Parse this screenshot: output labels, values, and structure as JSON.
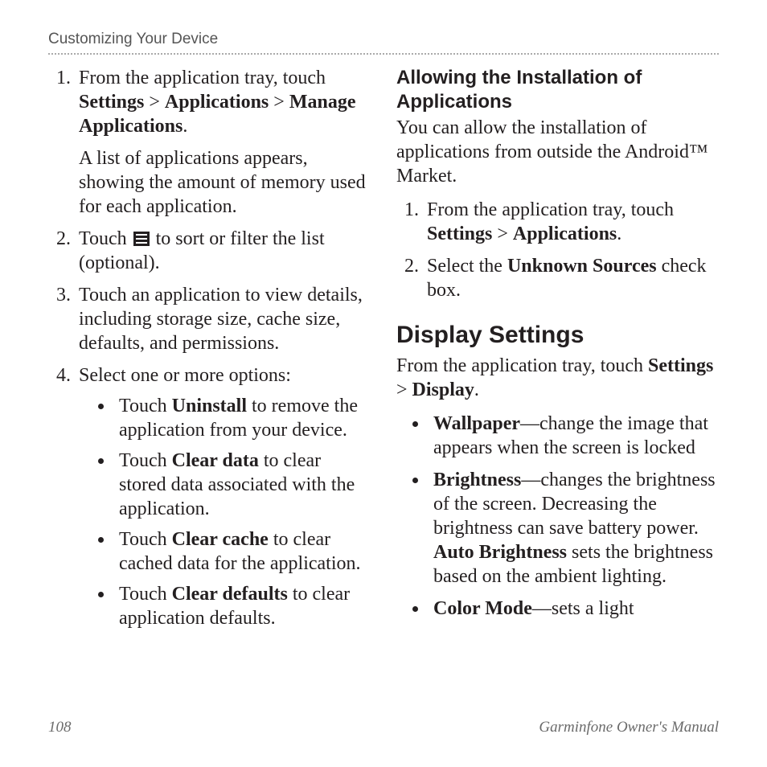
{
  "runningHead": "Customizing Your Device",
  "left": {
    "step1": {
      "prefix": "From the application tray, touch ",
      "b1": "Settings",
      "sep1": " > ",
      "b2": "Applications",
      "sep2": " > ",
      "b3": "Manage Applications",
      "suffix": ".",
      "follow": "A list of applications appears, showing the amount of memory used for each application."
    },
    "step2": {
      "prefix": "Touch ",
      "suffix": " to sort or filter the list (optional)."
    },
    "step3": "Touch an application to view details, including storage size, cache size, defaults, and permissions.",
    "step4": {
      "lead": "Select one or more options:",
      "opt1": {
        "p": "Touch ",
        "b": "Uninstall",
        "s": " to remove the application from your device."
      },
      "opt2": {
        "p": "Touch ",
        "b": "Clear data",
        "s": " to clear stored data associated with the application."
      },
      "opt3": {
        "p": "Touch ",
        "b": "Clear cache",
        "s": " to clear cached data for the application."
      },
      "opt4": {
        "p": "Touch ",
        "b": "Clear defaults",
        "s": " to clear application defaults."
      }
    }
  },
  "right": {
    "secTitle": "Allowing the Installation of Applications",
    "secIntro": "You can allow the installation of applications from outside the Android™ Market.",
    "step1": {
      "prefix": "From the application tray, touch ",
      "b1": "Settings",
      "sep1": " > ",
      "b2": "Applications",
      "suffix": "."
    },
    "step2": {
      "p": "Select the ",
      "b": "Unknown Sources",
      "s": " check box."
    },
    "h2": "Display Settings",
    "dsIntro": {
      "p": "From the application tray, touch ",
      "b1": "Settings",
      "sep": " > ",
      "b2": "Display",
      "suffix": "."
    },
    "feat1": {
      "b": "Wallpaper",
      "s": "—change the image that appears when the screen is locked"
    },
    "feat2": {
      "b1": "Brightness",
      "mid": "—changes the brightness of the screen. Decreasing the brightness can save battery power. ",
      "b2": "Auto Brightness",
      "s": " sets the brightness based on the ambient lighting."
    },
    "feat3": {
      "b": "Color Mode",
      "s": "—sets a light"
    }
  },
  "footer": {
    "page": "108",
    "doc": "Garminfone Owner's Manual"
  }
}
